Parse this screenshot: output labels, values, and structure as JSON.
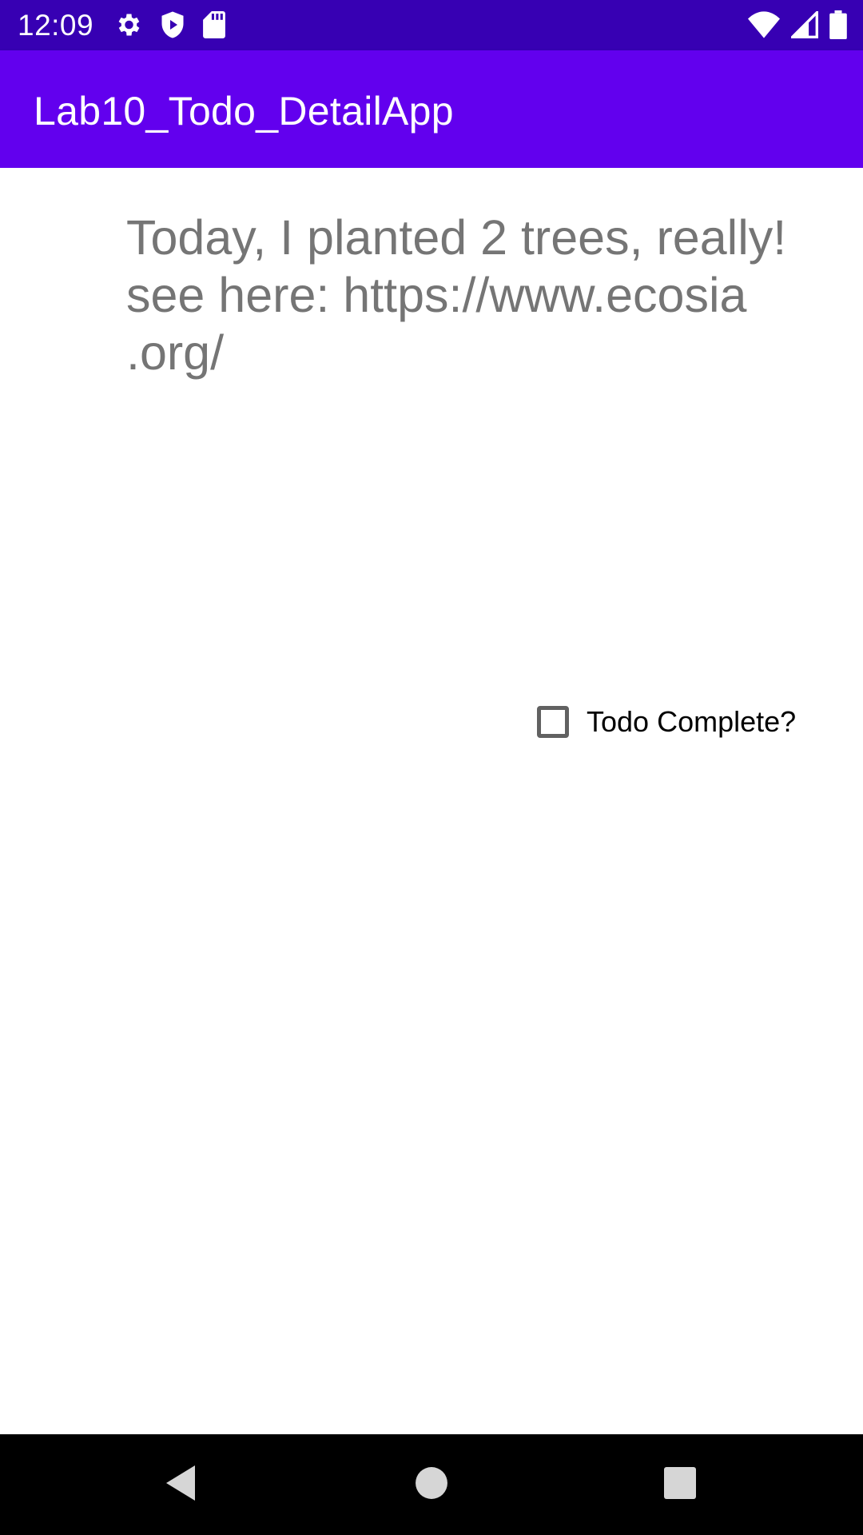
{
  "status_bar": {
    "time": "12:09",
    "left_icons": [
      "settings-icon",
      "shield-play-icon",
      "sd-card-icon"
    ],
    "right_icons": [
      "wifi-icon",
      "cellular-signal-icon",
      "battery-icon"
    ]
  },
  "app_bar": {
    "title": "Lab10_Todo_DetailApp",
    "color": "#6200EE",
    "status_color": "#3700B3"
  },
  "todo": {
    "text": "Today, I planted 2 trees, really!\nsee here: https://www.ecosia\n.org/",
    "checkbox_label": "Todo Complete?",
    "checked": false
  },
  "nav_bar": {
    "buttons": [
      "back-icon",
      "home-icon",
      "recents-icon"
    ]
  }
}
